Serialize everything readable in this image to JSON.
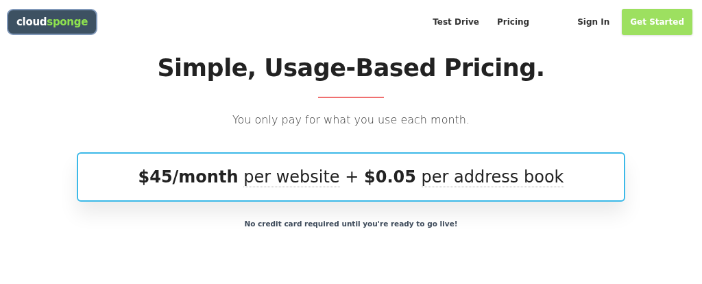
{
  "logo": {
    "primary": "cloud",
    "accent": "sponge"
  },
  "nav": {
    "links": [
      {
        "label": "Test Drive"
      },
      {
        "label": "Pricing"
      }
    ],
    "sign_in": "Sign In",
    "cta": "Get Started"
  },
  "hero": {
    "title": "Simple, Usage-Based Pricing.",
    "subtitle": "You only pay for what you use each month."
  },
  "pricing": {
    "parts": [
      {
        "kind": "amount",
        "text": "$45/month"
      },
      {
        "kind": "term",
        "text": "per website"
      },
      {
        "kind": "plain",
        "text": "+"
      },
      {
        "kind": "amount",
        "text": "$0.05"
      },
      {
        "kind": "term",
        "text": "per address book"
      }
    ],
    "note": "No credit card required until you're ready to go live!"
  }
}
